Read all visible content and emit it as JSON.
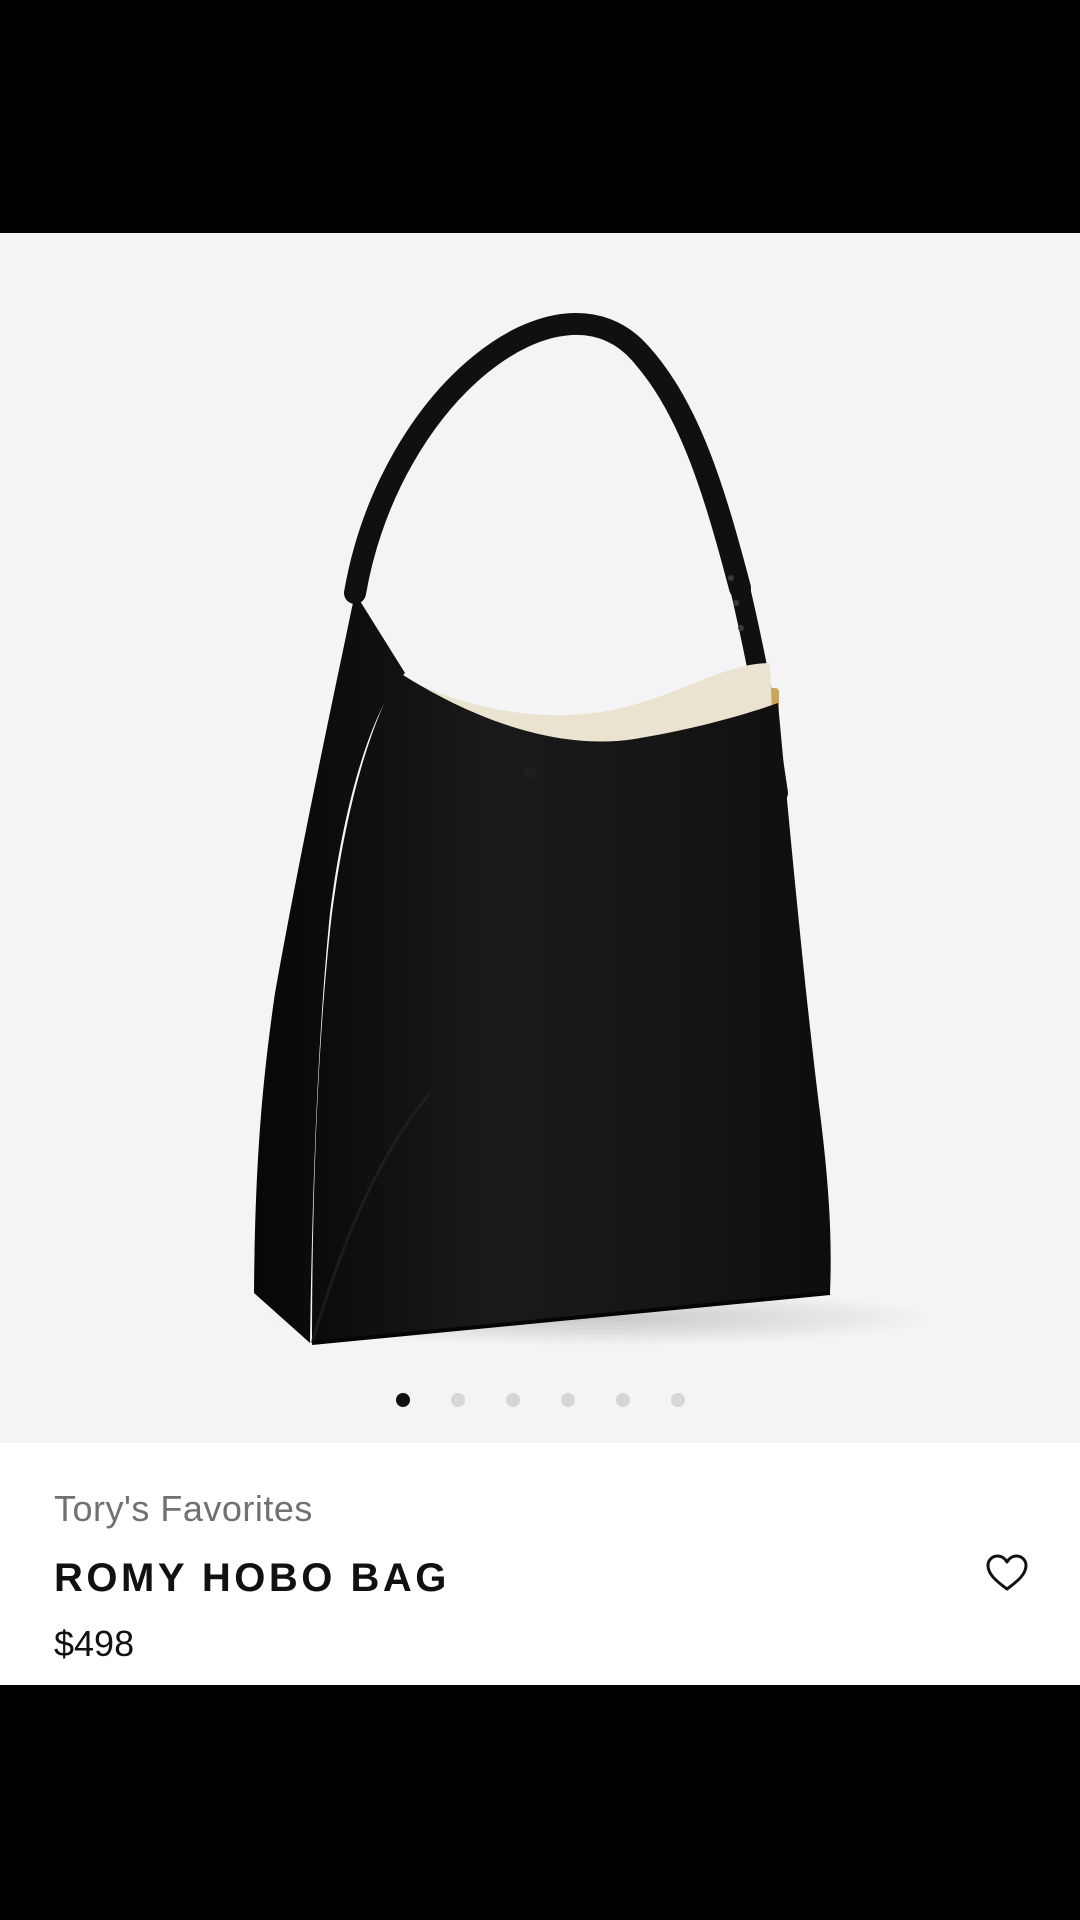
{
  "product": {
    "collection": "Tory's Favorites",
    "name": "ROMY HOBO BAG",
    "price": "$498"
  },
  "gallery": {
    "image_count": 6,
    "active_index": 0
  },
  "icons": {
    "wishlist": "heart-outline-icon"
  },
  "colors": {
    "image_background": "#f4f4f6",
    "bag": "#131313",
    "lining": "#e9e3cf",
    "hardware": "#c9a45c",
    "active_dot": "#111111",
    "inactive_dot": "#d6d6d9",
    "collection_text": "#707075",
    "primary_text": "#111111"
  }
}
